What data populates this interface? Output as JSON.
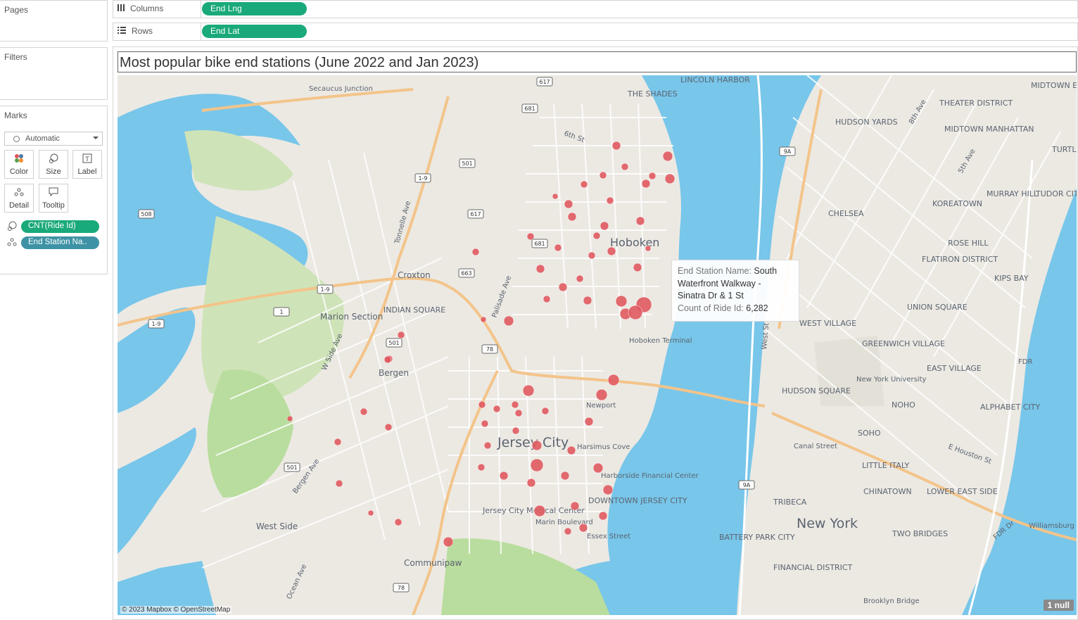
{
  "left_panel": {
    "pages_title": "Pages",
    "filters_title": "Filters",
    "marks_title": "Marks",
    "mark_type": "Automatic",
    "mark_buttons": [
      {
        "label": "Color",
        "icon": "color-dots-icon"
      },
      {
        "label": "Size",
        "icon": "size-icon"
      },
      {
        "label": "Label",
        "icon": "label-icon"
      },
      {
        "label": "Detail",
        "icon": "detail-icon"
      },
      {
        "label": "Tooltip",
        "icon": "tooltip-icon"
      }
    ],
    "mark_pills": [
      {
        "label": "CNT(Ride Id)",
        "color": "#1aa97a",
        "icon": "size-icon"
      },
      {
        "label": "End Station Na..",
        "color": "#3d93a5",
        "icon": "detail-icon"
      }
    ]
  },
  "shelves": {
    "columns_label": "Columns",
    "columns_pill": "End Lng",
    "rows_label": "Rows",
    "rows_pill": "End Lat"
  },
  "view": {
    "title": "Most popular bike end stations (June 2022 and Jan 2023)",
    "attribution": "© 2023 Mapbox © OpenStreetMap",
    "null_badge": "1 null",
    "mark_color": "#e05a5f"
  },
  "tooltip": {
    "field1_key": "End Station Name:",
    "field1_value_line1": "South",
    "field1_value_line2": "Waterfront Walkway -",
    "field1_value_line3": "Sinatra Dr & 1 St",
    "field2_key": "Count of Ride Id:",
    "field2_value": "6,282"
  },
  "map_labels": {
    "neighborhoods": [
      "Hoboken",
      "Jersey City",
      "New York",
      "Secaucus Junction",
      "THE SHADES",
      "LINCOLN HARBOR",
      "Croxton",
      "Marion Section",
      "INDIAN SQUARE",
      "Bergen",
      "West Side",
      "Communipaw",
      "Newport",
      "Harsimus Cove",
      "Harborside Financial Center",
      "DOWNTOWN JERSEY CITY",
      "Jersey City Medical Center",
      "Marin Boulevard",
      "Essex Street",
      "Hoboken Terminal",
      "HUDSON YARDS",
      "THEATER DISTRICT",
      "MIDTOWN MANHATTAN",
      "MIDTOWN EAST",
      "TURTLE BAY",
      "MURRAY HILL",
      "TUDOR CITY",
      "KOREATOWN",
      "CHELSEA",
      "ROSE HILL",
      "FLATIRON DISTRICT",
      "KIPS BAY",
      "UNION SQUARE",
      "WEST VILLAGE",
      "GREENWICH VILLAGE",
      "New York University",
      "EAST VILLAGE",
      "HUDSON SQUARE",
      "NOHO",
      "ALPHABET CITY",
      "SOHO",
      "Canal Street",
      "LITTLE ITALY",
      "CHINATOWN",
      "LOWER EAST SIDE",
      "TRIBECA",
      "TWO BRIDGES",
      "BATTERY PARK CITY",
      "FINANCIAL DISTRICT",
      "Brooklyn Bridge",
      "Williamsburg Bridge",
      "E Houston St",
      "FDR Dr",
      "8th Ave",
      "5th Ave",
      "West St",
      "6th St",
      "Palisade Ave",
      "Tonnelle Ave",
      "W Side Ave",
      "Bergen Ave",
      "Ocean Ave",
      "FDR"
    ],
    "route_shields": [
      "617",
      "681",
      "501",
      "617",
      "681",
      "663",
      "508",
      "1-9",
      "1-9",
      "1-9",
      "1",
      "501",
      "501",
      "78",
      "78",
      "9A",
      "9A"
    ]
  }
}
